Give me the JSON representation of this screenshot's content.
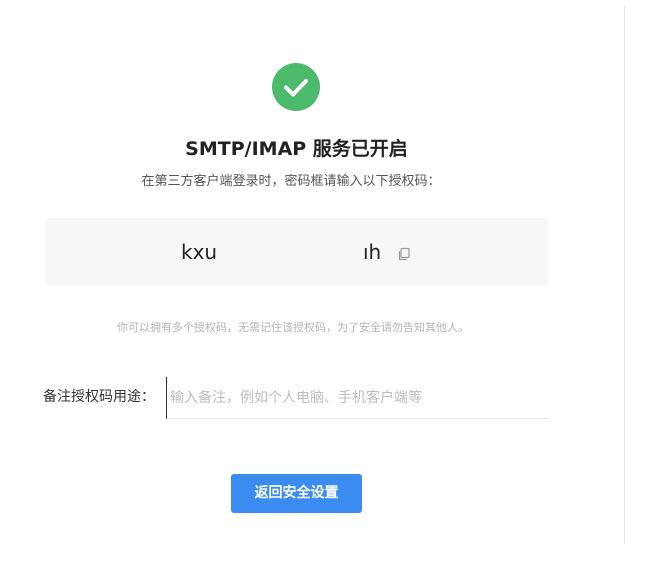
{
  "status": {
    "icon": "check-circle-icon",
    "icon_color": "#4cba6b",
    "title": "SMTP/IMAP 服务已开启",
    "subtitle": "在第三方客户端登录时，密码框请输入以下授权码："
  },
  "auth_code": {
    "visible_start": "kxu",
    "visible_end": "ıh",
    "copy_icon": "copy-icon"
  },
  "tip": "你可以拥有多个授权码，无需记住该授权码，为了安全请勿告知其他人。",
  "note": {
    "label": "备注授权码用途：",
    "value": "",
    "placeholder": "输入备注，例如个人电脑、手机客户端等"
  },
  "actions": {
    "back_label": "返回安全设置",
    "accent": "#3b8cf0"
  }
}
